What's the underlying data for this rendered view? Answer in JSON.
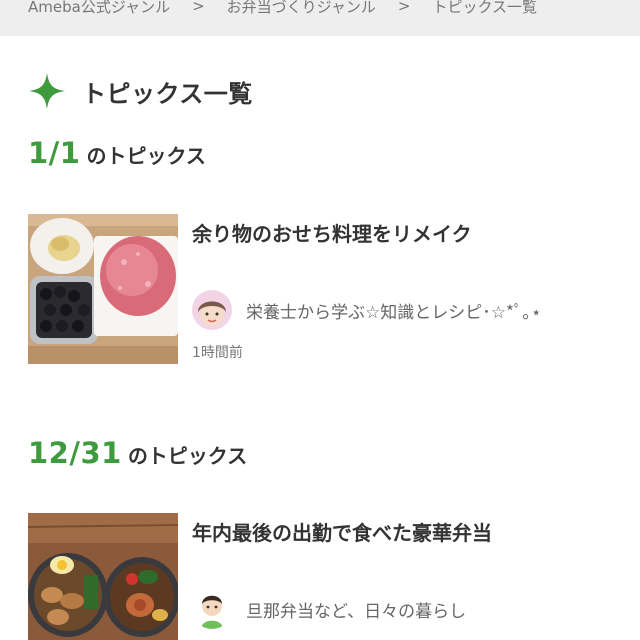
{
  "breadcrumb": {
    "items": [
      "Ameba公式ジャンル",
      "お弁当づくりジャンル",
      "トピックス一覧"
    ],
    "separator": ">"
  },
  "page": {
    "title": "トピックス一覧",
    "accent_color": "#3d9a3d"
  },
  "sections": [
    {
      "date": "1/1",
      "date_suffix": "のトピックス",
      "card": {
        "title": "余り物のおせち料理をリメイク",
        "author": "栄養士から学ぶ☆知識とレシピ･☆*ﾟ｡⋆",
        "time": "1時間前"
      }
    },
    {
      "date": "12/31",
      "date_suffix": "のトピックス",
      "card": {
        "title": "年内最後の出勤で食べた豪華弁当",
        "author": "旦那弁当など、日々の暮らし"
      }
    }
  ]
}
